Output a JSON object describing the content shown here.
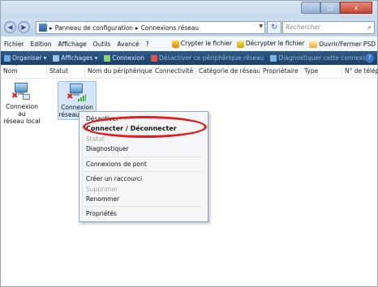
{
  "window": {
    "controls": {
      "minimize": "–",
      "maximize": "□",
      "close": "x"
    }
  },
  "address": {
    "back": "◀",
    "forward": "▶",
    "breadcrumb_sep": "▸",
    "crumbs": [
      "Panneau de configuration",
      "Connexions réseau"
    ],
    "refresh": "↻",
    "search_placeholder": "Rechercher",
    "search_icon": "⌕"
  },
  "menu": {
    "items": [
      "Fichier",
      "Edition",
      "Affichage",
      "Outils",
      "Avancé",
      "?"
    ],
    "right": [
      "Crypter le fichier",
      "Décrypter le fichier",
      "Ouvrir/Fermer PSD"
    ]
  },
  "commands": {
    "items": [
      {
        "label": "Organiser",
        "arrow": "▾"
      },
      {
        "label": "Affichages",
        "arrow": "▾"
      },
      {
        "label": "Connexion"
      },
      {
        "label": "Désactiver ce périphérique réseau"
      },
      {
        "label": "Diagnostiquer cette connexion"
      }
    ],
    "more": "»",
    "help": "?"
  },
  "columns": [
    "Nom",
    "Statut",
    "Nom du périphérique",
    "Connectivité",
    "Catégorie de réseau",
    "Propriétaire",
    "Type",
    "N° de télép..."
  ],
  "sort_indicator": "˄",
  "connections": [
    {
      "label_line1": "Connexion au",
      "label_line2": "réseau local",
      "status": "disabled",
      "icon": "wired-network-icon"
    },
    {
      "label_line1": "Connexion",
      "label_line2": "réseau sans",
      "status": "disconnected",
      "icon": "wireless-network-icon"
    }
  ],
  "context_menu": {
    "items": [
      {
        "label": "Désactiver",
        "state": "partial"
      },
      {
        "label": "Connecter / Déconnecter",
        "state": "highlighted"
      },
      {
        "label": "Statut",
        "state": "disabled"
      },
      {
        "label": "Diagnostiquer",
        "state": "enabled"
      },
      {
        "label": "Connexions de pont",
        "state": "enabled"
      },
      {
        "label": "Créer un raccourci",
        "state": "enabled"
      },
      {
        "label": "Supprimer",
        "state": "disabled"
      },
      {
        "label": "Renommer",
        "state": "enabled"
      },
      {
        "label": "Propriétés",
        "state": "enabled"
      }
    ]
  },
  "colors": {
    "command_bar": "#1f4670",
    "highlight_oval": "#e01e1e",
    "selection": "#d5e6fb"
  }
}
